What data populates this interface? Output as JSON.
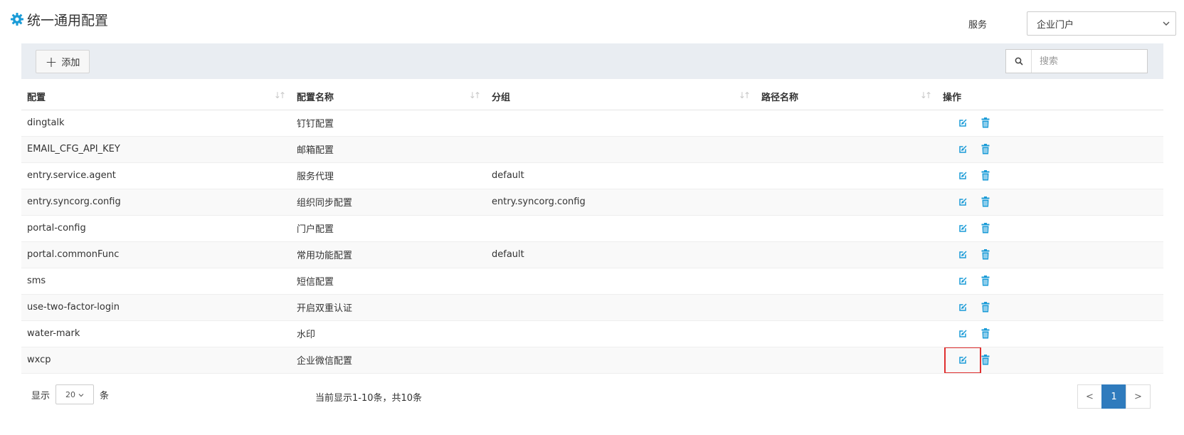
{
  "page": {
    "title": "统一通用配置"
  },
  "service": {
    "label": "服务",
    "selected": "企业门户"
  },
  "toolbar": {
    "add_label": "添加",
    "search_placeholder": "搜索"
  },
  "table": {
    "columns": [
      "配置",
      "配置名称",
      "分组",
      "路径名称",
      "操作"
    ],
    "rows": [
      {
        "config": "dingtalk",
        "name": "钉钉配置",
        "group": "",
        "path": ""
      },
      {
        "config": "EMAIL_CFG_API_KEY",
        "name": "邮箱配置",
        "group": "",
        "path": ""
      },
      {
        "config": "entry.service.agent",
        "name": "服务代理",
        "group": "default",
        "path": ""
      },
      {
        "config": "entry.syncorg.config",
        "name": "组织同步配置",
        "group": "entry.syncorg.config",
        "path": ""
      },
      {
        "config": "portal-config",
        "name": "门户配置",
        "group": "",
        "path": ""
      },
      {
        "config": "portal.commonFunc",
        "name": "常用功能配置",
        "group": "default",
        "path": ""
      },
      {
        "config": "sms",
        "name": "短信配置",
        "group": "",
        "path": ""
      },
      {
        "config": "use-two-factor-login",
        "name": "开启双重认证",
        "group": "",
        "path": ""
      },
      {
        "config": "water-mark",
        "name": "水印",
        "group": "",
        "path": ""
      },
      {
        "config": "wxcp",
        "name": "企业微信配置",
        "group": "",
        "path": ""
      }
    ]
  },
  "footer": {
    "show_label": "显示",
    "page_size": "20",
    "unit_label": "条",
    "summary": "当前显示1-10条，共10条",
    "prev": "<",
    "current_page": "1",
    "next": ">"
  },
  "colors": {
    "accent": "#1a9bd7",
    "pager_active": "#2f7bbd",
    "highlight": "#e03030"
  }
}
